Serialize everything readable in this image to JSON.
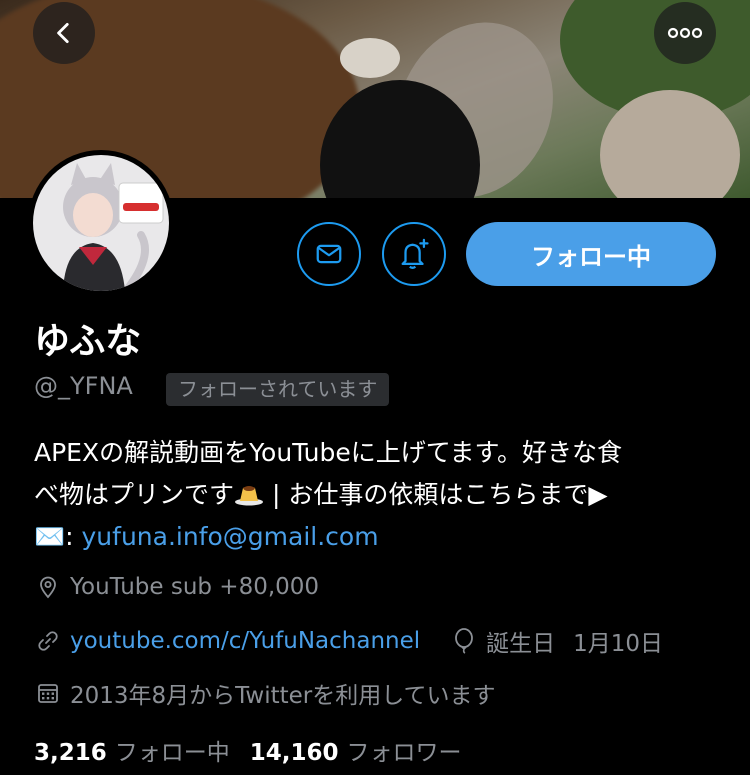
{
  "header": {
    "back_icon": "chevron-left-icon",
    "more_icon": "more-horizontal-icon"
  },
  "actions": {
    "message_icon": "mail-icon",
    "notify_icon": "bell-plus-icon",
    "follow_label": "フォロー中",
    "accent_color": "#4a9fe8"
  },
  "profile": {
    "display_name": "ゆふな",
    "handle": "@_YFNA",
    "follows_you_badge": "フォローされています",
    "bio_line1": "APEXの解説動画をYouTubeに上げてます。好きな食",
    "bio_line2_a": "べ物はプリンです",
    "bio_line2_b": " | お仕事の依頼はこちらまで▶",
    "bio_line3_prefix": "✉️: ",
    "bio_email": "yufuna.info@gmail.com",
    "location": "YouTube sub +80,000",
    "website": "youtube.com/c/YufuNachannel",
    "birthday_label": "誕生日",
    "birthday_value": "1月10日",
    "joined": "2013年8月からTwitterを利用しています"
  },
  "stats": {
    "following_count": "3,216",
    "following_label": "フォロー中",
    "followers_count": "14,160",
    "followers_label": "フォロワー"
  }
}
